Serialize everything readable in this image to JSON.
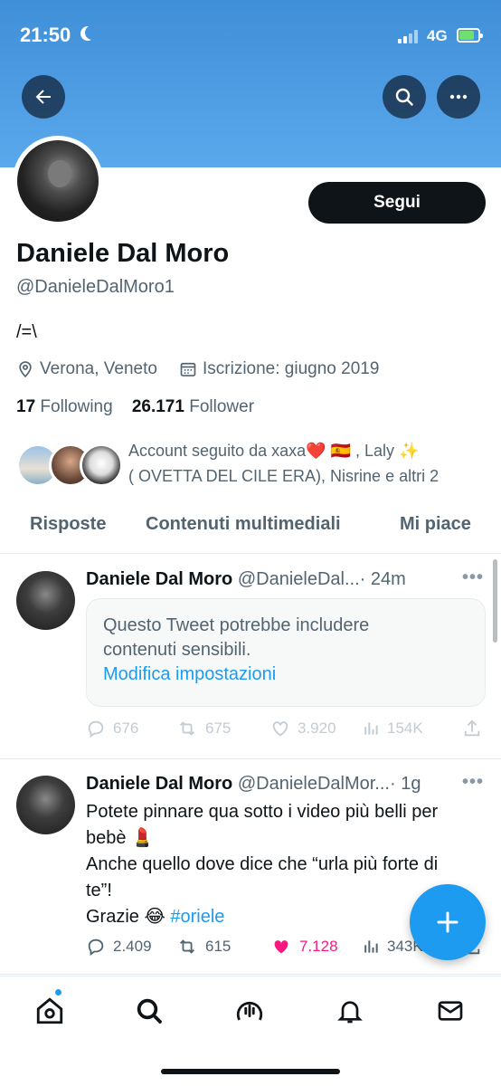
{
  "status_bar": {
    "time": "21:50",
    "network": "4G"
  },
  "profile": {
    "follow_label": "Segui",
    "display_name": "Daniele Dal Moro",
    "handle": "@DanieleDalMoro1",
    "bio": "/=\\",
    "location": "Verona, Veneto",
    "joined": "Iscrizione: giugno 2019",
    "following_count": "17",
    "following_label": "Following",
    "followers_count": "26.171",
    "followers_label": "Follower",
    "followed_by_line1": "Account seguito da xaxa❤️ 🇪🇸 , Laly ✨",
    "followed_by_line2": "( OVETTA DEL CILE ERA), Nisrine e altri 2"
  },
  "tabs": [
    "Risposte",
    "Contenuti multimediali",
    "Mi piace"
  ],
  "tweets": [
    {
      "name": "Daniele Dal Moro",
      "handle": "@DanieleDal...",
      "time": "· 24m",
      "sensitive_line1": "Questo Tweet potrebbe includere",
      "sensitive_line2": "contenuti sensibili.",
      "sensitive_link": "Modifica impostazioni",
      "replies": "676",
      "retweets": "675",
      "likes": "3.920",
      "views": "154K"
    },
    {
      "name": "Daniele Dal Moro",
      "handle": "@DanieleDalMor...",
      "time": "· 1g",
      "text_line1": "Potete pinnare qua sotto i video più belli per",
      "text_line2": "bebè 💄",
      "text_line3": "Anche quello dove dice che “urla più forte di",
      "text_line4": "te”!",
      "text_line5_prefix": "Grazie 😂 ",
      "hashtag": "#oriele",
      "replies": "2.409",
      "retweets": "615",
      "likes": "7.128",
      "views": "343K"
    }
  ],
  "colors": {
    "accent": "#1d9bf0",
    "like": "#f91880",
    "text": "#0f1419",
    "muted": "#536471"
  },
  "icons": [
    "back-arrow-icon",
    "search-icon",
    "more-icon",
    "location-icon",
    "calendar-icon",
    "reply-icon",
    "retweet-icon",
    "heart-icon",
    "views-icon",
    "share-icon",
    "plus-icon",
    "home-icon",
    "spaces-icon",
    "bell-icon",
    "mail-icon"
  ]
}
